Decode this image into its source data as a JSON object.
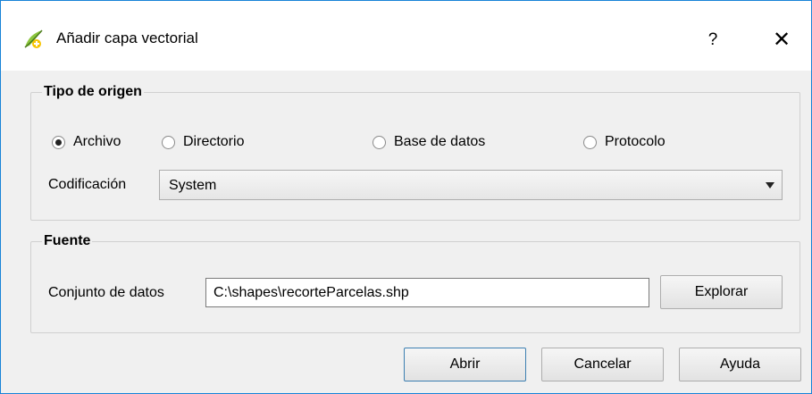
{
  "window": {
    "title": "Añadir capa vectorial",
    "help_label": "?",
    "close_label": "✕"
  },
  "source_type": {
    "group_title": "Tipo de origen",
    "options": [
      {
        "label": "Archivo",
        "checked": true
      },
      {
        "label": "Directorio",
        "checked": false
      },
      {
        "label": "Base de datos",
        "checked": false
      },
      {
        "label": "Protocolo",
        "checked": false
      }
    ],
    "encoding_label": "Codificación",
    "encoding_value": "System"
  },
  "source": {
    "group_title": "Fuente",
    "dataset_label": "Conjunto de datos",
    "dataset_value": "C:\\shapes\\recorteParcelas.shp",
    "browse_label": "Explorar"
  },
  "buttons": {
    "open": "Abrir",
    "cancel": "Cancelar",
    "help": "Ayuda"
  },
  "icons": {
    "app": "qgis-add-vector-icon",
    "dropdown": "chevron-down-icon"
  }
}
